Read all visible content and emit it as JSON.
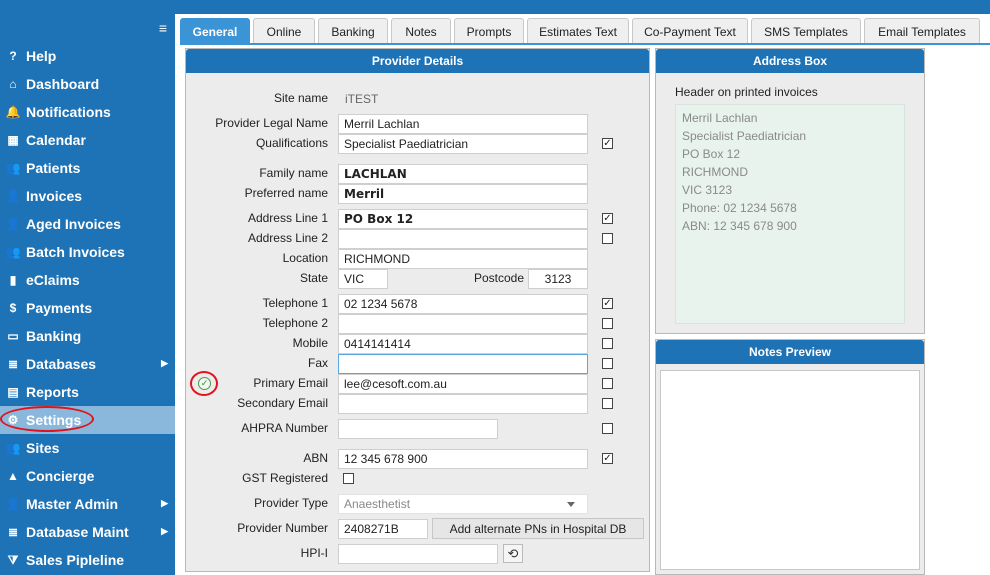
{
  "sidebar": {
    "items": [
      {
        "label": "Help",
        "icon": "question-icon",
        "glyph": "?"
      },
      {
        "label": "Dashboard",
        "icon": "home-icon",
        "glyph": "⌂"
      },
      {
        "label": "Notifications",
        "icon": "bell-icon",
        "glyph": "🔔"
      },
      {
        "label": "Calendar",
        "icon": "calendar-icon",
        "glyph": "▦"
      },
      {
        "label": "Patients",
        "icon": "users-icon",
        "glyph": "👥"
      },
      {
        "label": "Invoices",
        "icon": "user-icon",
        "glyph": "👤"
      },
      {
        "label": "Aged Invoices",
        "icon": "user-clock-icon",
        "glyph": "👤"
      },
      {
        "label": "Batch Invoices",
        "icon": "users-icon",
        "glyph": "👥"
      },
      {
        "label": "eClaims",
        "icon": "file-icon",
        "glyph": "▮"
      },
      {
        "label": "Payments",
        "icon": "dollar-icon",
        "glyph": "$"
      },
      {
        "label": "Banking",
        "icon": "card-icon",
        "glyph": "▭"
      },
      {
        "label": "Databases",
        "icon": "database-icon",
        "glyph": "≣",
        "chevron": true
      },
      {
        "label": "Reports",
        "icon": "report-icon",
        "glyph": "▤"
      },
      {
        "label": "Settings",
        "icon": "gear-icon",
        "glyph": "⚙",
        "active": true
      },
      {
        "label": "Sites",
        "icon": "users-icon",
        "glyph": "👥"
      },
      {
        "label": "Concierge",
        "icon": "bell-service-icon",
        "glyph": "▲"
      },
      {
        "label": "Master Admin",
        "icon": "user-cog-icon",
        "glyph": "👤",
        "chevron": true
      },
      {
        "label": "Database Maint",
        "icon": "database-icon",
        "glyph": "≣",
        "chevron": true
      },
      {
        "label": "Sales Pipleline",
        "icon": "funnel-icon",
        "glyph": "⧩"
      }
    ]
  },
  "tabs": [
    {
      "label": "General",
      "active": true
    },
    {
      "label": "Online"
    },
    {
      "label": "Banking"
    },
    {
      "label": "Notes"
    },
    {
      "label": "Prompts"
    },
    {
      "label": "Estimates Text"
    },
    {
      "label": "Co-Payment Text"
    },
    {
      "label": "SMS Templates"
    },
    {
      "label": "Email Templates"
    }
  ],
  "provider": {
    "title": "Provider Details",
    "site_name_label": "Site name",
    "site_name": "iTEST",
    "legal_name_label": "Provider Legal Name",
    "legal_name": "Merril Lachlan",
    "qualifications_label": "Qualifications",
    "qualifications": "Specialist Paediatrician",
    "family_name_label": "Family name",
    "family_name": "LACHLAN",
    "preferred_name_label": "Preferred name",
    "preferred_name": "Merril",
    "address1_label": "Address Line 1",
    "address1": "PO Box 12",
    "address2_label": "Address Line 2",
    "address2": "",
    "location_label": "Location",
    "location": "RICHMOND",
    "state_label": "State",
    "state": "VIC",
    "postcode_label": "Postcode",
    "postcode": "3123",
    "telephone1_label": "Telephone 1",
    "telephone1": "02 1234 5678",
    "telephone2_label": "Telephone 2",
    "telephone2": "",
    "mobile_label": "Mobile",
    "mobile": "0414141414",
    "fax_label": "Fax",
    "fax": "",
    "primary_email_label": "Primary Email",
    "primary_email": "lee@cesoft.com.au",
    "secondary_email_label": "Secondary Email",
    "secondary_email": "",
    "ahpra_label": "AHPRA Number",
    "ahpra": "",
    "abn_label": "ABN",
    "abn": "12 345 678 900",
    "gst_label": "GST Registered",
    "provider_type_label": "Provider Type",
    "provider_type": "Anaesthetist",
    "provider_number_label": "Provider Number",
    "provider_number": "2408271B",
    "alt_pn_button": "Add alternate PNs in Hospital DB",
    "hpii_label": "HPI-I",
    "hpii": ""
  },
  "checks": {
    "qualifications": true,
    "address1": true,
    "address2": false,
    "telephone1": true,
    "telephone2": false,
    "mobile": false,
    "fax": false,
    "primary_email": false,
    "secondary_email": false,
    "ahpra": false,
    "abn": true,
    "gst": false
  },
  "address_box": {
    "title": "Address Box",
    "header_label": "Header on printed invoices",
    "lines": [
      "Merril Lachlan",
      "Specialist Paediatrician",
      "PO Box 12",
      "RICHMOND",
      "VIC 3123",
      "Phone: 02 1234 5678",
      "ABN: 12 345 678 900"
    ]
  },
  "notes_preview": {
    "title": "Notes Preview"
  },
  "glyphs": {
    "hamburger": "≡",
    "chevron": "▶",
    "check": "✓",
    "refresh": "⟲"
  }
}
